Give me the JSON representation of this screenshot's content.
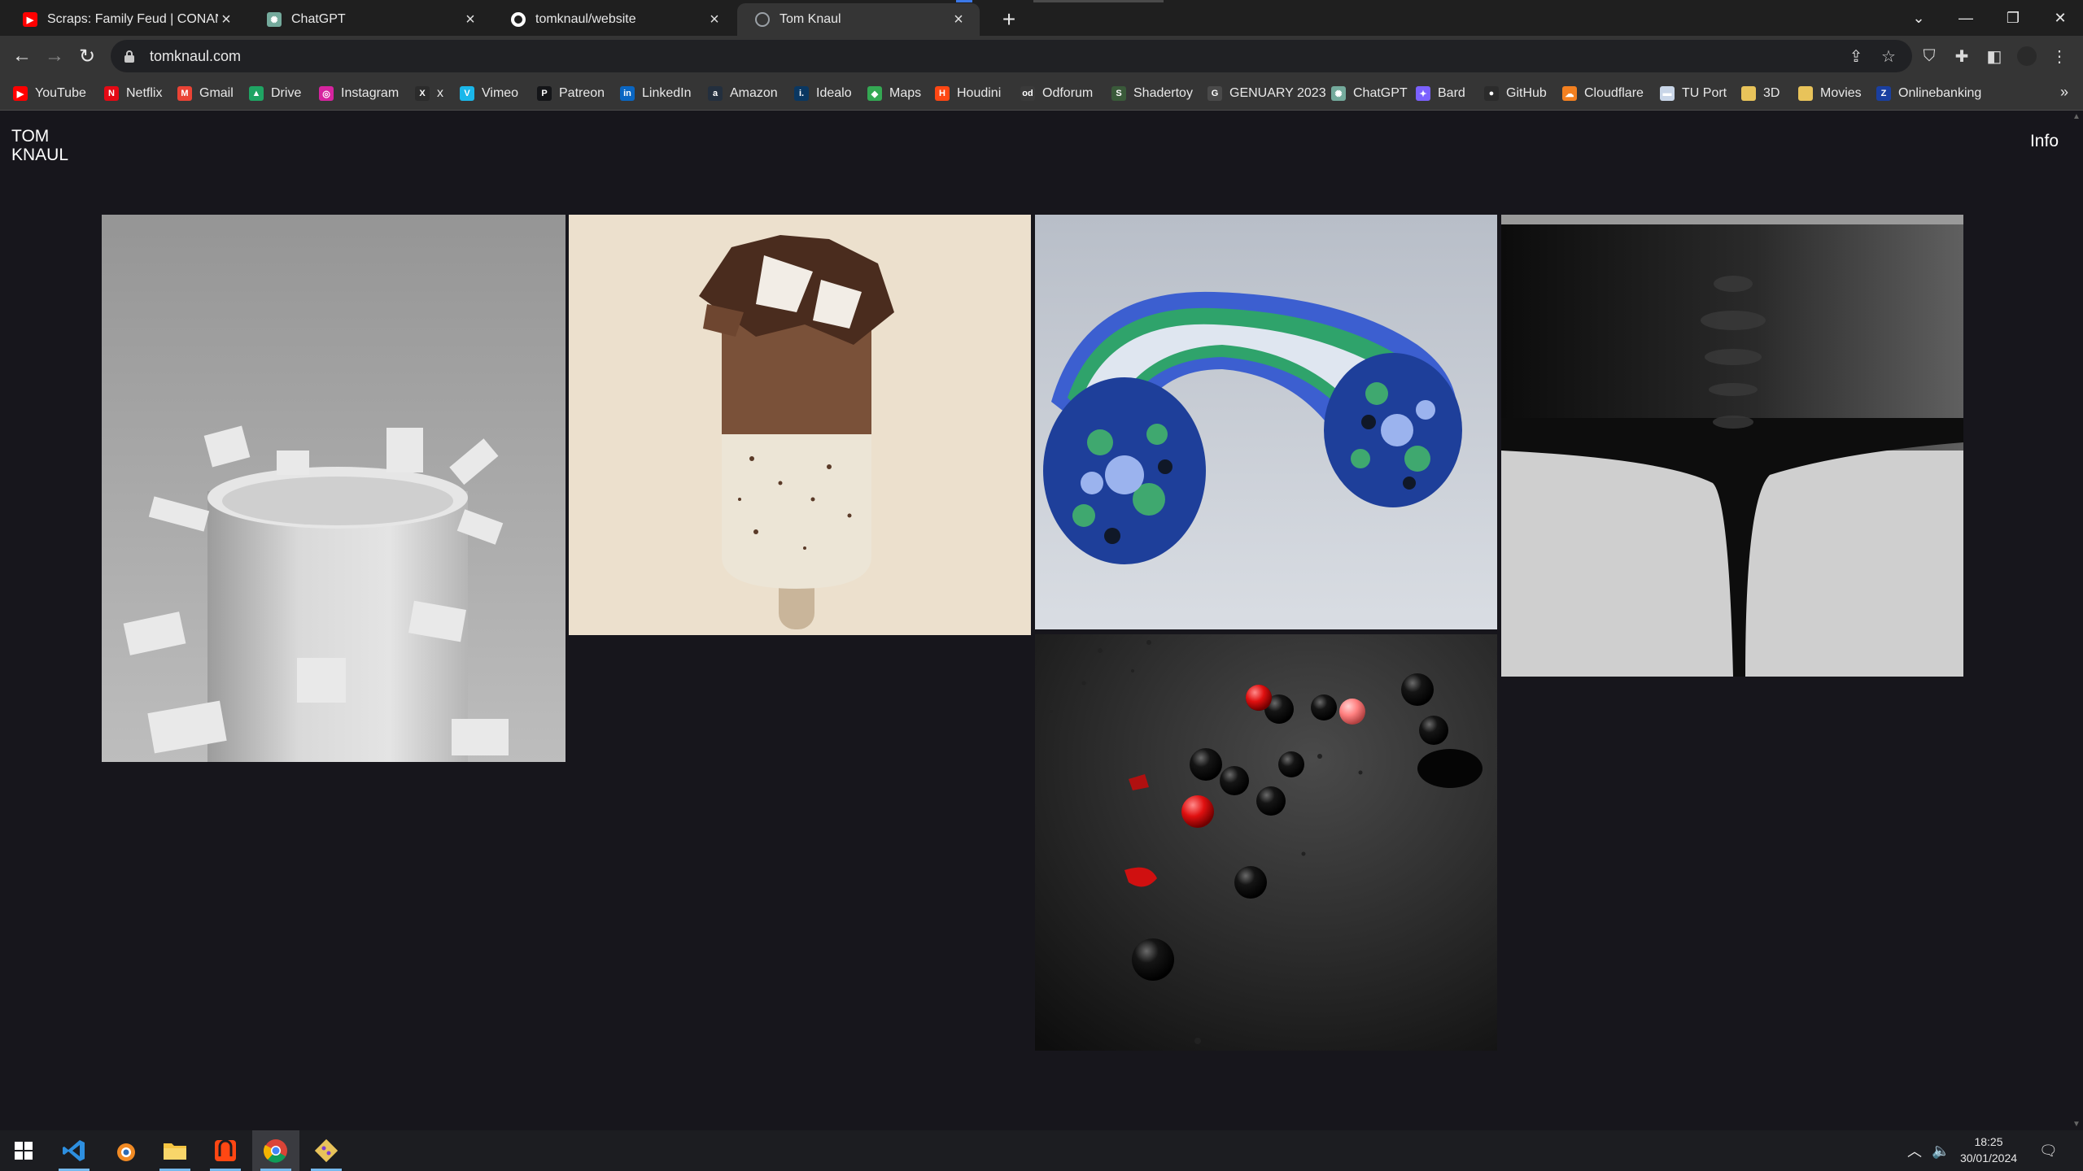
{
  "tabs": [
    {
      "title": "Scraps: Family Feud | CONAN on",
      "icon": "youtube-icon",
      "color": "#ff0000"
    },
    {
      "title": "ChatGPT",
      "icon": "chatgpt-icon",
      "color": "#74aa9c"
    },
    {
      "title": "tomknaul/website",
      "icon": "github-icon",
      "color": "#ffffff"
    },
    {
      "title": "Tom Knaul",
      "icon": "globe-icon",
      "color": "#9aa0a6"
    }
  ],
  "address_bar": {
    "url": "tomknaul.com"
  },
  "bookmarks": [
    {
      "label": "YouTube",
      "icon": "youtube-icon",
      "color": "#ff0000",
      "glyph": "▶"
    },
    {
      "label": "Netflix",
      "icon": "netflix-icon",
      "color": "#e50914",
      "glyph": "N"
    },
    {
      "label": "Gmail",
      "icon": "gmail-icon",
      "color": "#ea4335",
      "glyph": "M"
    },
    {
      "label": "Drive",
      "icon": "drive-icon",
      "color": "#1fa463",
      "glyph": "▲"
    },
    {
      "label": "Instagram",
      "icon": "instagram-icon",
      "color": "#d6249f",
      "glyph": "◎"
    },
    {
      "label": "x",
      "icon": "x-icon",
      "color": "#2b2b2b",
      "glyph": "X"
    },
    {
      "label": "Vimeo",
      "icon": "vimeo-icon",
      "color": "#1ab7ea",
      "glyph": "V"
    },
    {
      "label": "Patreon",
      "icon": "patreon-icon",
      "color": "#141518",
      "glyph": "P"
    },
    {
      "label": "LinkedIn",
      "icon": "linkedin-icon",
      "color": "#0a66c2",
      "glyph": "in"
    },
    {
      "label": "Amazon",
      "icon": "amazon-icon",
      "color": "#232f3e",
      "glyph": "a"
    },
    {
      "label": "Idealo",
      "icon": "idealo-icon",
      "color": "#0a3761",
      "glyph": "i."
    },
    {
      "label": "Maps",
      "icon": "maps-icon",
      "color": "#34a853",
      "glyph": "◆"
    },
    {
      "label": "Houdini",
      "icon": "houdini-icon",
      "color": "#ff4713",
      "glyph": "H"
    },
    {
      "label": "Odforum",
      "icon": "odforum-icon",
      "color": "#3a3a3a",
      "glyph": "od"
    },
    {
      "label": "Shadertoy",
      "icon": "shadertoy-icon",
      "color": "#3a5a3a",
      "glyph": "S"
    },
    {
      "label": "GENUARY 2023",
      "icon": "genuary-icon",
      "color": "#4a4a4a",
      "glyph": "G"
    },
    {
      "label": "ChatGPT",
      "icon": "chatgpt-icon",
      "color": "#74aa9c",
      "glyph": "✺"
    },
    {
      "label": "Bard",
      "icon": "bard-icon",
      "color": "#7b61ff",
      "glyph": "✦"
    },
    {
      "label": "GitHub",
      "icon": "github-icon",
      "color": "#2b2b2b",
      "glyph": "●"
    },
    {
      "label": "Cloudflare",
      "icon": "cloudflare-icon",
      "color": "#f38020",
      "glyph": "☁"
    },
    {
      "label": "TU Port",
      "icon": "tu-port-icon",
      "color": "#c9d6e8",
      "glyph": "▬"
    },
    {
      "label": "3D",
      "icon": "folder-icon",
      "color": "#e8c35a",
      "glyph": ""
    },
    {
      "label": "Movies",
      "icon": "folder-icon",
      "color": "#e8c35a",
      "glyph": ""
    },
    {
      "label": "Onlinebanking",
      "icon": "bank-icon",
      "color": "#1a3fa0",
      "glyph": "Z"
    }
  ],
  "page": {
    "logo_line1": "TOM",
    "logo_line2": "KNAUL",
    "info_label": "Info"
  },
  "gallery": [
    {
      "subject": "white jigsaw puzzle cylinder"
    },
    {
      "subject": "chocolate ice cream popsicle"
    },
    {
      "subject": "blue green circle spiral sculpture"
    },
    {
      "subject": "black liquid surface"
    },
    {
      "subject": "black and red spheres"
    }
  ],
  "taskbar": {
    "apps": [
      "windows-start-icon",
      "vscode-icon",
      "blender-icon",
      "file-explorer-icon",
      "houdini-icon",
      "chrome-icon",
      "git-icon"
    ],
    "time": "18:25",
    "date": "30/01/2024"
  }
}
